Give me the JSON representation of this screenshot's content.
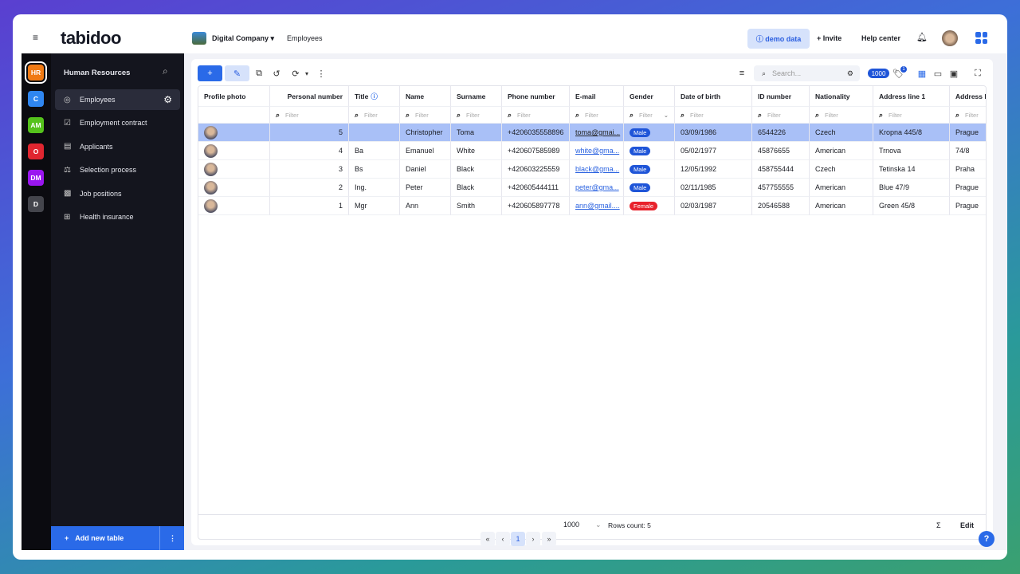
{
  "header": {
    "logo": "tabidoo",
    "workspace": "Digital Company",
    "breadcrumb": "Employees",
    "demo_label": "demo data",
    "invite_label": "Invite",
    "help_label": "Help center"
  },
  "rail": [
    {
      "label": "HR",
      "color": "#f07a14"
    },
    {
      "label": "C",
      "color": "#2f86f0"
    },
    {
      "label": "AM",
      "color": "#55c21c"
    },
    {
      "label": "O",
      "color": "#e02630"
    },
    {
      "label": "DM",
      "color": "#9a16f0"
    },
    {
      "label": "D",
      "color": "#44454c"
    }
  ],
  "sidebar": {
    "title": "Human Resources",
    "items": [
      {
        "label": "Employees",
        "icon": "person-circle-icon",
        "active": true
      },
      {
        "label": "Employment contract",
        "icon": "edit-square-icon"
      },
      {
        "label": "Applicants",
        "icon": "contact-card-icon"
      },
      {
        "label": "Selection process",
        "icon": "scales-icon"
      },
      {
        "label": "Job positions",
        "icon": "grid-icon"
      },
      {
        "label": "Health insurance",
        "icon": "medical-case-icon"
      }
    ],
    "add_label": "Add new table"
  },
  "toolbar": {
    "add": "+",
    "search_placeholder": "Search...",
    "record_limit": "1000",
    "tag_badge": "1"
  },
  "table": {
    "columns": [
      "Profile photo",
      "Personal number",
      "Title",
      "Name",
      "Surname",
      "Phone number",
      "E-mail",
      "Gender",
      "Date of birth",
      "ID number",
      "Nationality",
      "Address line 1",
      "Address l"
    ],
    "filter_placeholder": "Filter",
    "rows": [
      [
        "",
        "5",
        "",
        "Christopher",
        "Toma",
        "+4206035558896",
        "toma@gmai...",
        "Male",
        "03/09/1986",
        "6544226",
        "Czech",
        "Kropna 445/8",
        "Prague"
      ],
      [
        "",
        "4",
        "Ba",
        "Emanuel",
        "White",
        "+420607585989",
        "white@gma...",
        "Male",
        "05/02/1977",
        "45876655",
        "American",
        "Trnova",
        "74/8"
      ],
      [
        "",
        "3",
        "Bs",
        "Daniel",
        "Black",
        "+420603225559",
        "black@gma...",
        "Male",
        "12/05/1992",
        "458755444",
        "Czech",
        "Tetinska 14",
        "Praha"
      ],
      [
        "",
        "2",
        "Ing.",
        "Peter",
        "Black",
        "+420605444111",
        "peter@gma...",
        "Male",
        "02/11/1985",
        "457755555",
        "American",
        "Blue 47/9",
        "Prague"
      ],
      [
        "",
        "1",
        "Mgr",
        "Ann",
        "Smith",
        "+420605897778",
        "ann@gmail....",
        "Female",
        "02/03/1987",
        "20546588",
        "American",
        "Green 45/8",
        "Prague"
      ]
    ]
  },
  "footer": {
    "first": "«",
    "prev": "‹",
    "page": "1",
    "next": "›",
    "last": "»",
    "page_size": "1000",
    "rows_count": "Rows count: 5",
    "sum": "Σ",
    "edit": "Edit"
  },
  "help_button": "?"
}
